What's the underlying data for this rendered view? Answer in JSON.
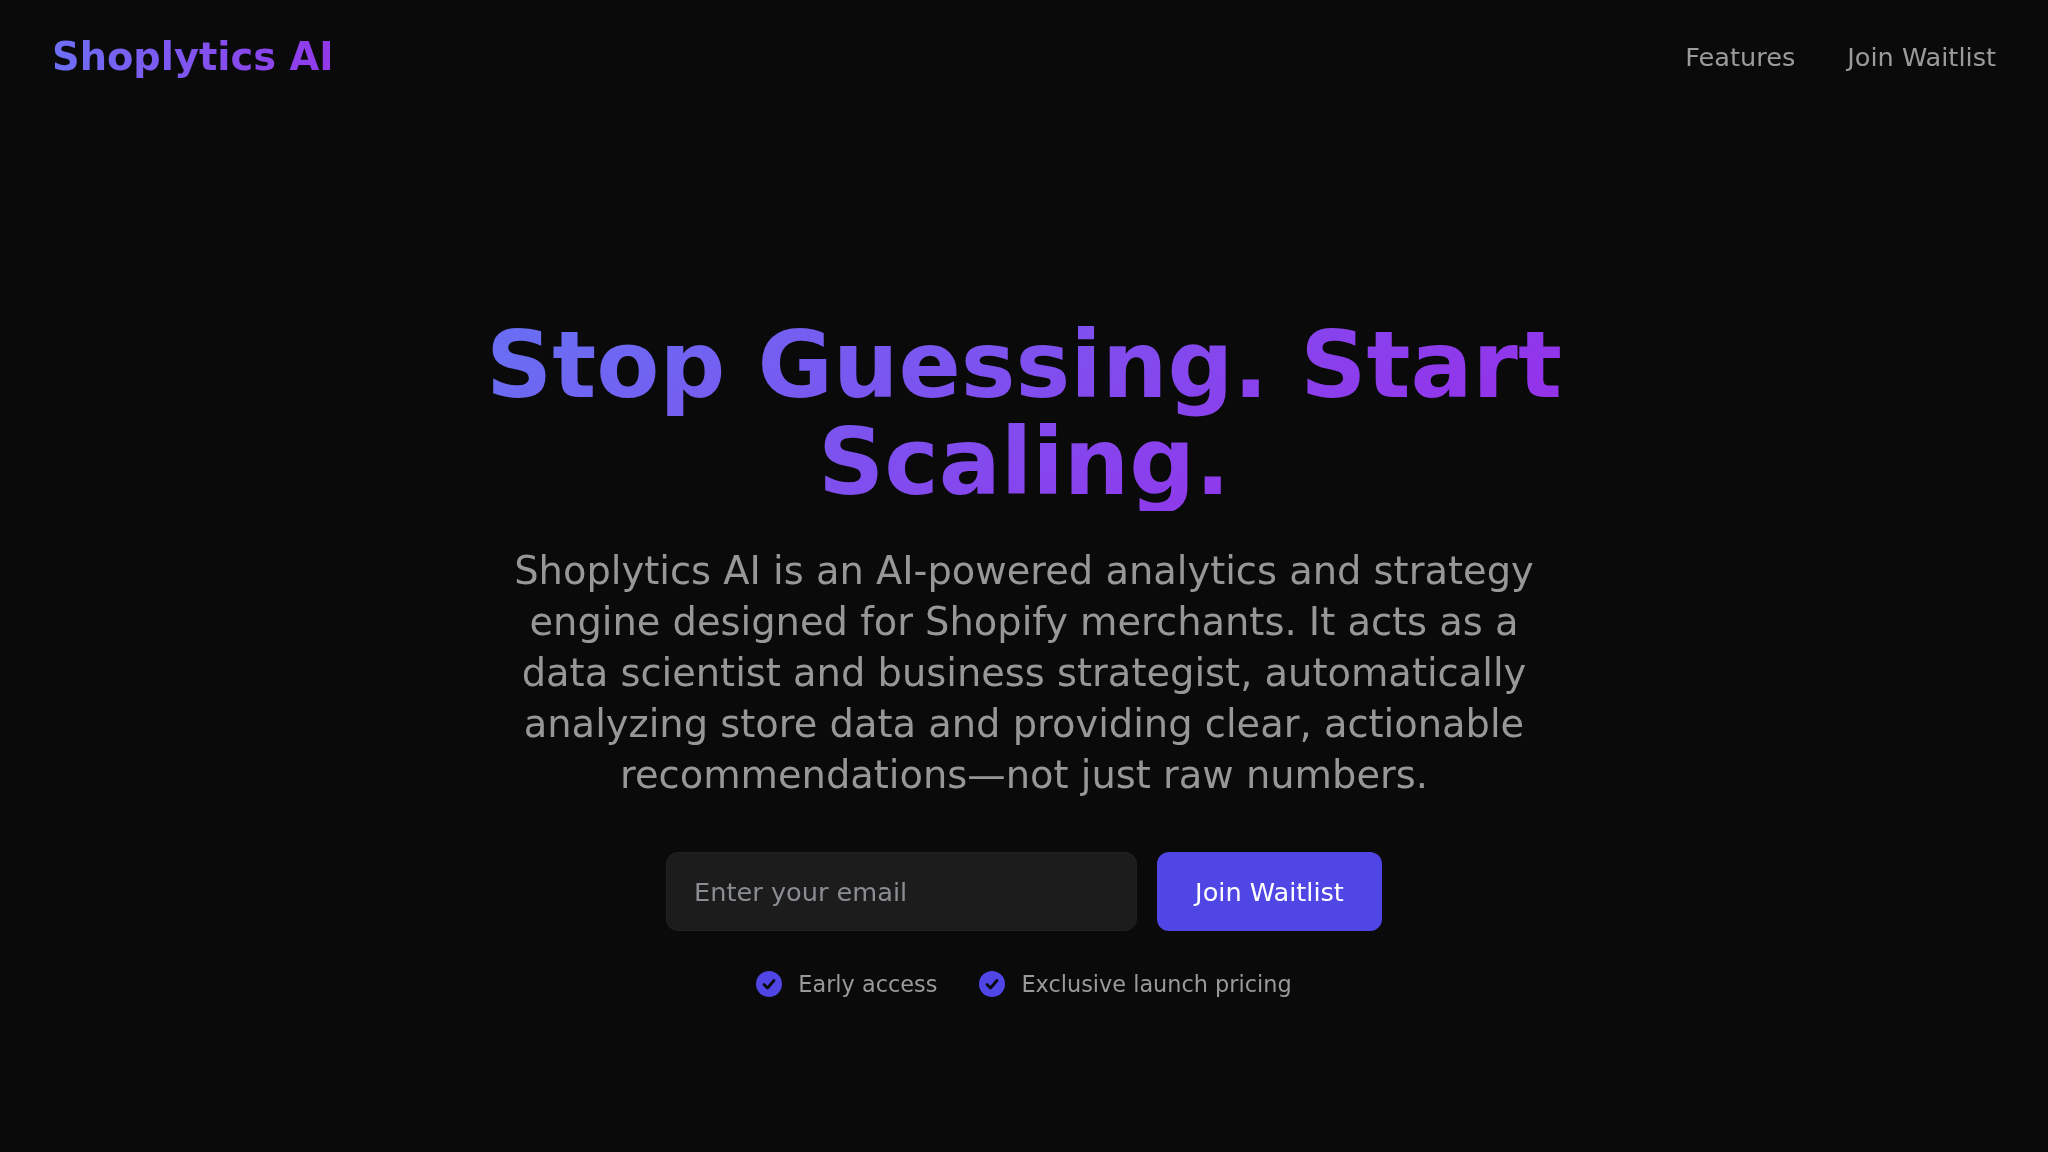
{
  "header": {
    "logo": "Shoplytics AI",
    "nav": [
      {
        "label": "Features"
      },
      {
        "label": "Join Waitlist"
      }
    ]
  },
  "hero": {
    "headline": "Stop Guessing. Start Scaling.",
    "description": "Shoplytics AI is an AI-powered analytics and strategy engine designed for Shopify merchants. It acts as a data scientist and business strategist, automatically analyzing store data and providing clear, actionable recommendations—not just raw numbers.",
    "signup": {
      "placeholder": "Enter your email",
      "button": "Join Waitlist"
    },
    "perks": [
      "Early access",
      "Exclusive launch pricing"
    ]
  }
}
